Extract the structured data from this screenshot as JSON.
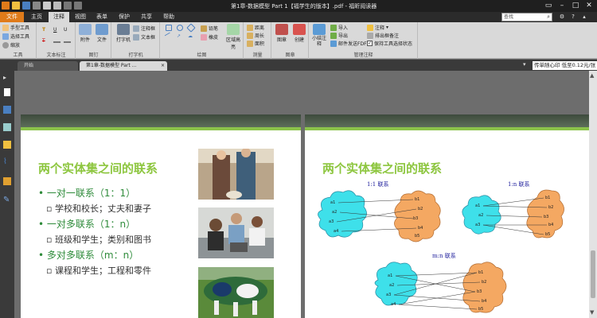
{
  "window": {
    "title": "第1章-数据模型 Part 1【福学生的版本】.pdf - 福昕阅读器",
    "controls": [
      "restore-icon",
      "minimize-icon",
      "maximize-icon",
      "close-icon"
    ]
  },
  "menu": {
    "items": [
      "文件",
      "主页",
      "注释",
      "视图",
      "表单",
      "保护",
      "共享",
      "帮助"
    ],
    "active": "注释",
    "search_placeholder": "查找"
  },
  "ribbon": {
    "tools": {
      "hand": "手型工具",
      "select": "选择工具",
      "zoom": "缩放",
      "label": "工具"
    },
    "text_markup": {
      "label": "文本标注",
      "glyphs": [
        "T",
        "U",
        "U",
        "T"
      ]
    },
    "pin": {
      "attach": "附件",
      "file": "文件",
      "label": "图钉"
    },
    "typewriter": {
      "typewriter": "打字机",
      "callout": "注释框",
      "textbox": "文本框",
      "label": "打字机"
    },
    "drawing": {
      "pencil": "铅笔",
      "eraser": "橡皮",
      "highlight_area": "区域高亮",
      "label": "绘图"
    },
    "measure": {
      "distance": "距离",
      "perimeter": "周长",
      "area": "面积",
      "label": "测量"
    },
    "stamp": {
      "stamp": "图章",
      "create": "创建",
      "label": "图章"
    },
    "manage": {
      "summary": "小结注释",
      "import": "导入",
      "export": "导出",
      "send_pdf": "邮件发送FDF",
      "comments": "注释",
      "arrange": "排出框备注",
      "keep_tool": "保持工具选择状态",
      "label": "管理注释"
    }
  },
  "tabs": [
    {
      "label": "开始",
      "active": false
    },
    {
      "label": "第1章-数据模型 Part ...",
      "active": true
    }
  ],
  "stamp_field": "传单随心印 低至0.12元/张",
  "slides": {
    "left": {
      "title": "两个实体集之间的联系",
      "bullets": [
        {
          "level": 1,
          "text": "• 一对一联系（1：1）"
        },
        {
          "level": 2,
          "text": "▫ 学校和校长；丈夫和妻子"
        },
        {
          "level": 1,
          "text": "• 一对多联系（1：n）"
        },
        {
          "level": 2,
          "text": "▫ 班级和学生；类别和图书"
        },
        {
          "level": 1,
          "text": "• 多对多联系（m：n）"
        },
        {
          "level": 2,
          "text": "▫ 课程和学生；工程和零件"
        }
      ]
    },
    "right": {
      "title": "两个实体集之间的联系",
      "diagrams": [
        {
          "label": "1:1 联系",
          "left": [
            "a1",
            "a2",
            "a3",
            "a4"
          ],
          "right": [
            "b1",
            "b2",
            "b3",
            "b4",
            "b5"
          ]
        },
        {
          "label": "1:n 联系",
          "left": [
            "a1",
            "a2",
            "a3"
          ],
          "right": [
            "b1",
            "b2",
            "b3",
            "b4",
            "b5"
          ]
        },
        {
          "label": "m:n 联系",
          "left": [
            "a1",
            "a2",
            "a3",
            "a4"
          ],
          "right": [
            "b1",
            "b2",
            "b3",
            "b4",
            "b5"
          ]
        }
      ]
    }
  },
  "colors": {
    "accent": "#e07b1a",
    "title_green": "#8dc63f",
    "bullet_green": "#2e8b3a",
    "cloud_cyan": "#3ee0ea",
    "cloud_orange": "#f4a862"
  }
}
